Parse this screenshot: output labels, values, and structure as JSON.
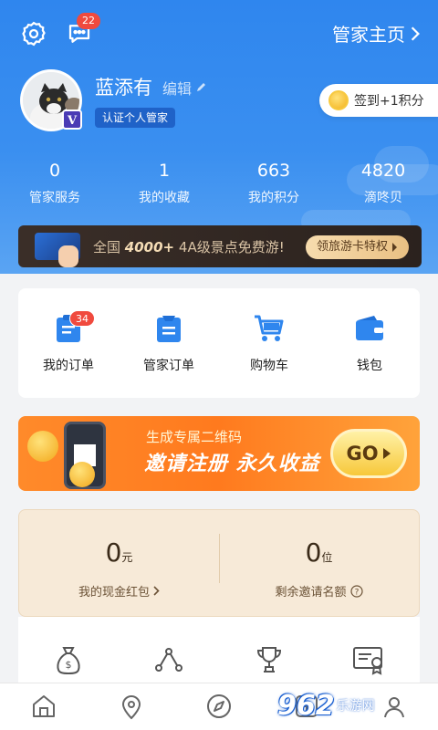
{
  "header": {
    "message_badge": "22",
    "home_link": "管家主页",
    "username": "蓝添有",
    "edit_label": "编辑",
    "verify_label": "认证个人管家",
    "signin_label": "签到+1积分",
    "level_badge": "V"
  },
  "stats": [
    {
      "value": "0",
      "label": "管家服务"
    },
    {
      "value": "1",
      "label": "我的收藏"
    },
    {
      "value": "663",
      "label": "我的积分"
    },
    {
      "value": "4820",
      "label": "滴咚贝"
    }
  ],
  "promo": {
    "text_prefix": "全国",
    "text_highlight": "4000+",
    "text_suffix": "4A级景点免费游!",
    "button": "领旅游卡特权"
  },
  "orders": [
    {
      "label": "我的订单",
      "badge": "34",
      "icon": "clipboard-icon"
    },
    {
      "label": "管家订单",
      "badge": "",
      "icon": "butler-clipboard-icon"
    },
    {
      "label": "购物车",
      "badge": "",
      "icon": "cart-icon"
    },
    {
      "label": "钱包",
      "badge": "",
      "icon": "wallet-icon"
    }
  ],
  "invite": {
    "subtitle": "生成专属二维码",
    "title": "邀请注册 永久收益",
    "go": "GO"
  },
  "cash": [
    {
      "value": "0",
      "unit": "元",
      "label": "我的现金红包"
    },
    {
      "value": "0",
      "unit": "位",
      "label": "剩余邀请名额"
    }
  ],
  "tools": [
    "money-bag-icon",
    "route-icon",
    "trophy-icon",
    "certificate-icon"
  ],
  "bottom_nav": [
    {
      "icon": "home-icon",
      "label": ""
    },
    {
      "icon": "location-icon",
      "label": ""
    },
    {
      "icon": "compass-icon",
      "label": ""
    },
    {
      "icon": "add-icon",
      "label": ""
    },
    {
      "icon": "profile-icon",
      "label": ""
    }
  ],
  "watermark": {
    "logo": "962",
    "sub": "乐游网"
  },
  "colors": {
    "primary": "#2f86ee",
    "badge": "#f04a3e",
    "invite": "#ff7a1e"
  }
}
